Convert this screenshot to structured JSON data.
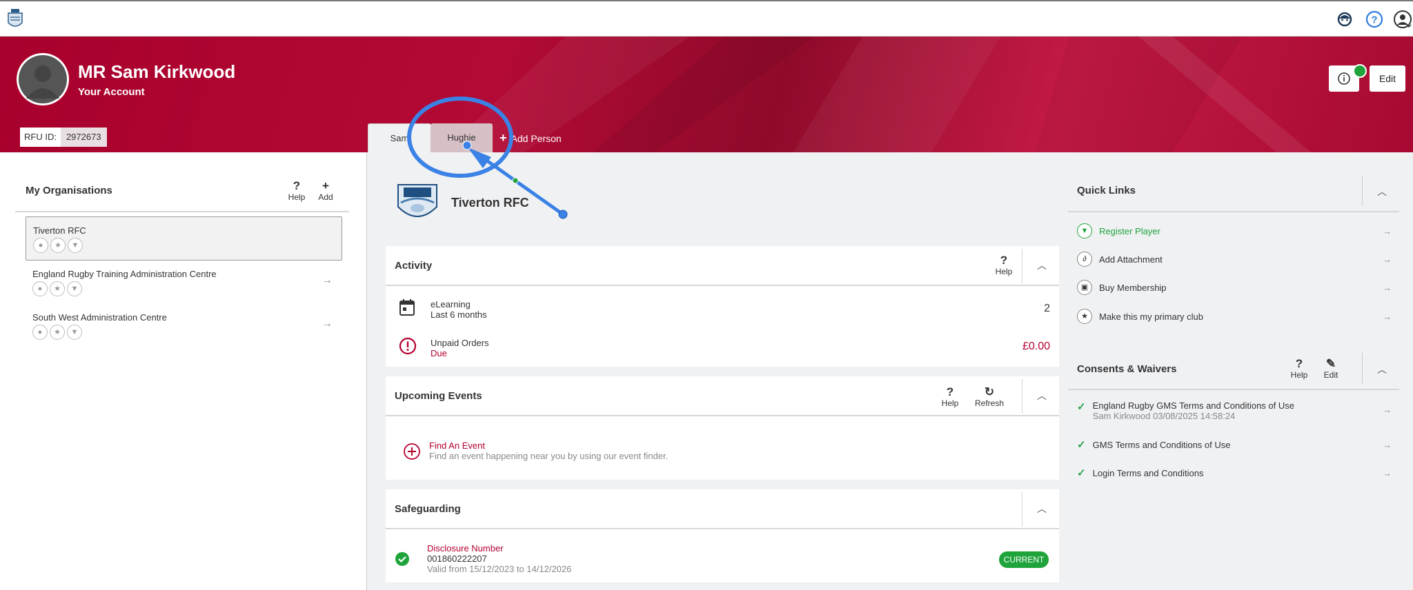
{
  "header": {
    "logo_icon": "club-crest-icon",
    "icons": [
      "support-agent-icon",
      "help-circle-icon",
      "user-menu-icon"
    ]
  },
  "profile": {
    "name": "MR Sam Kirkwood",
    "subtitle": "Your Account",
    "rfu_label": "RFU ID:",
    "rfu_id": "2972673",
    "edit_label": "Edit",
    "status_color": "#1fa33b"
  },
  "tabs": [
    {
      "label": "Sam"
    },
    {
      "label": "Hughie"
    }
  ],
  "add_person_label": "Add Person",
  "organisations": {
    "title": "My Organisations",
    "help_label": "Help",
    "add_label": "Add",
    "items": [
      {
        "name": "Tiverton RFC"
      },
      {
        "name": "England Rugby Training Administration Centre"
      },
      {
        "name": "South West Administration Centre"
      }
    ]
  },
  "club": {
    "name": "Tiverton RFC"
  },
  "activity": {
    "title": "Activity",
    "help_label": "Help",
    "rows": [
      {
        "title": "eLearning",
        "sub": "Last 6 months",
        "value": "2"
      },
      {
        "title": "Unpaid Orders",
        "sub": "Due",
        "value": "£0.00"
      }
    ]
  },
  "events": {
    "title": "Upcoming Events",
    "help_label": "Help",
    "refresh_label": "Refresh",
    "find_title": "Find An Event",
    "find_sub": "Find an event happening near you by using our event finder."
  },
  "safeguarding": {
    "title": "Safeguarding",
    "item_title": "Disclosure Number",
    "number": "001860222207",
    "validity": "Valid from 15/12/2023 to 14/12/2026",
    "status": "CURRENT"
  },
  "quick_links": {
    "title": "Quick Links",
    "items": [
      {
        "label": "Register Player",
        "icon": "shirt-icon"
      },
      {
        "label": "Add Attachment",
        "icon": "paperclip-icon"
      },
      {
        "label": "Buy Membership",
        "icon": "membership-card-icon"
      },
      {
        "label": "Make this my primary club",
        "icon": "star-icon"
      }
    ]
  },
  "consents": {
    "title": "Consents & Waivers",
    "help_label": "Help",
    "edit_label": "Edit",
    "items": [
      {
        "label": "England Rugby GMS Terms and Conditions of Use",
        "sub": "Sam Kirkwood 03/08/2025 14:58:24"
      },
      {
        "label": "GMS Terms and Conditions of Use"
      },
      {
        "label": "Login Terms and Conditions"
      }
    ]
  },
  "colors": {
    "brand": "#b3002d",
    "success": "#1fa33b",
    "annotation": "#3b82e6"
  }
}
